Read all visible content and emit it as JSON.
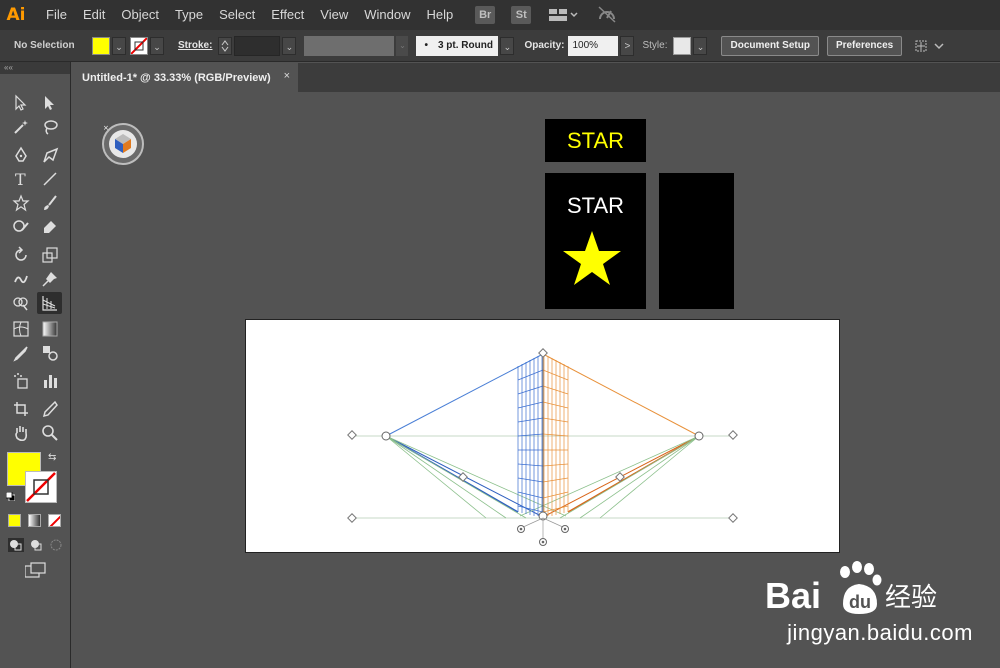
{
  "app": {
    "logo": "Ai",
    "menu": [
      "File",
      "Edit",
      "Object",
      "Type",
      "Select",
      "Effect",
      "View",
      "Window",
      "Help"
    ],
    "bridge_buttons": [
      "Br",
      "St"
    ]
  },
  "control_bar": {
    "selection_status": "No Selection",
    "fill_color": "#ffff00",
    "stroke_label": "Stroke:",
    "brush_value": "3 pt. Round",
    "opacity_label": "Opacity:",
    "opacity_value": "100%",
    "opacity_arrow": ">",
    "style_label": "Style:",
    "document_setup_label": "Document Setup",
    "preferences_label": "Preferences"
  },
  "tools_panel": {
    "header_glyph": "««",
    "fill_color": "#ffff00",
    "swap_glyph": "⇆"
  },
  "document": {
    "tab_title": "Untitled-1* @ 33.33% (RGB/Preview)",
    "close_glyph": "×"
  },
  "artwork": {
    "star_label_small": "STAR",
    "star_card_label": "STAR",
    "star_color": "#ffff00"
  },
  "watermark": {
    "text": "jingyan.baidu.com",
    "logo_text": "Bai du 经验"
  }
}
